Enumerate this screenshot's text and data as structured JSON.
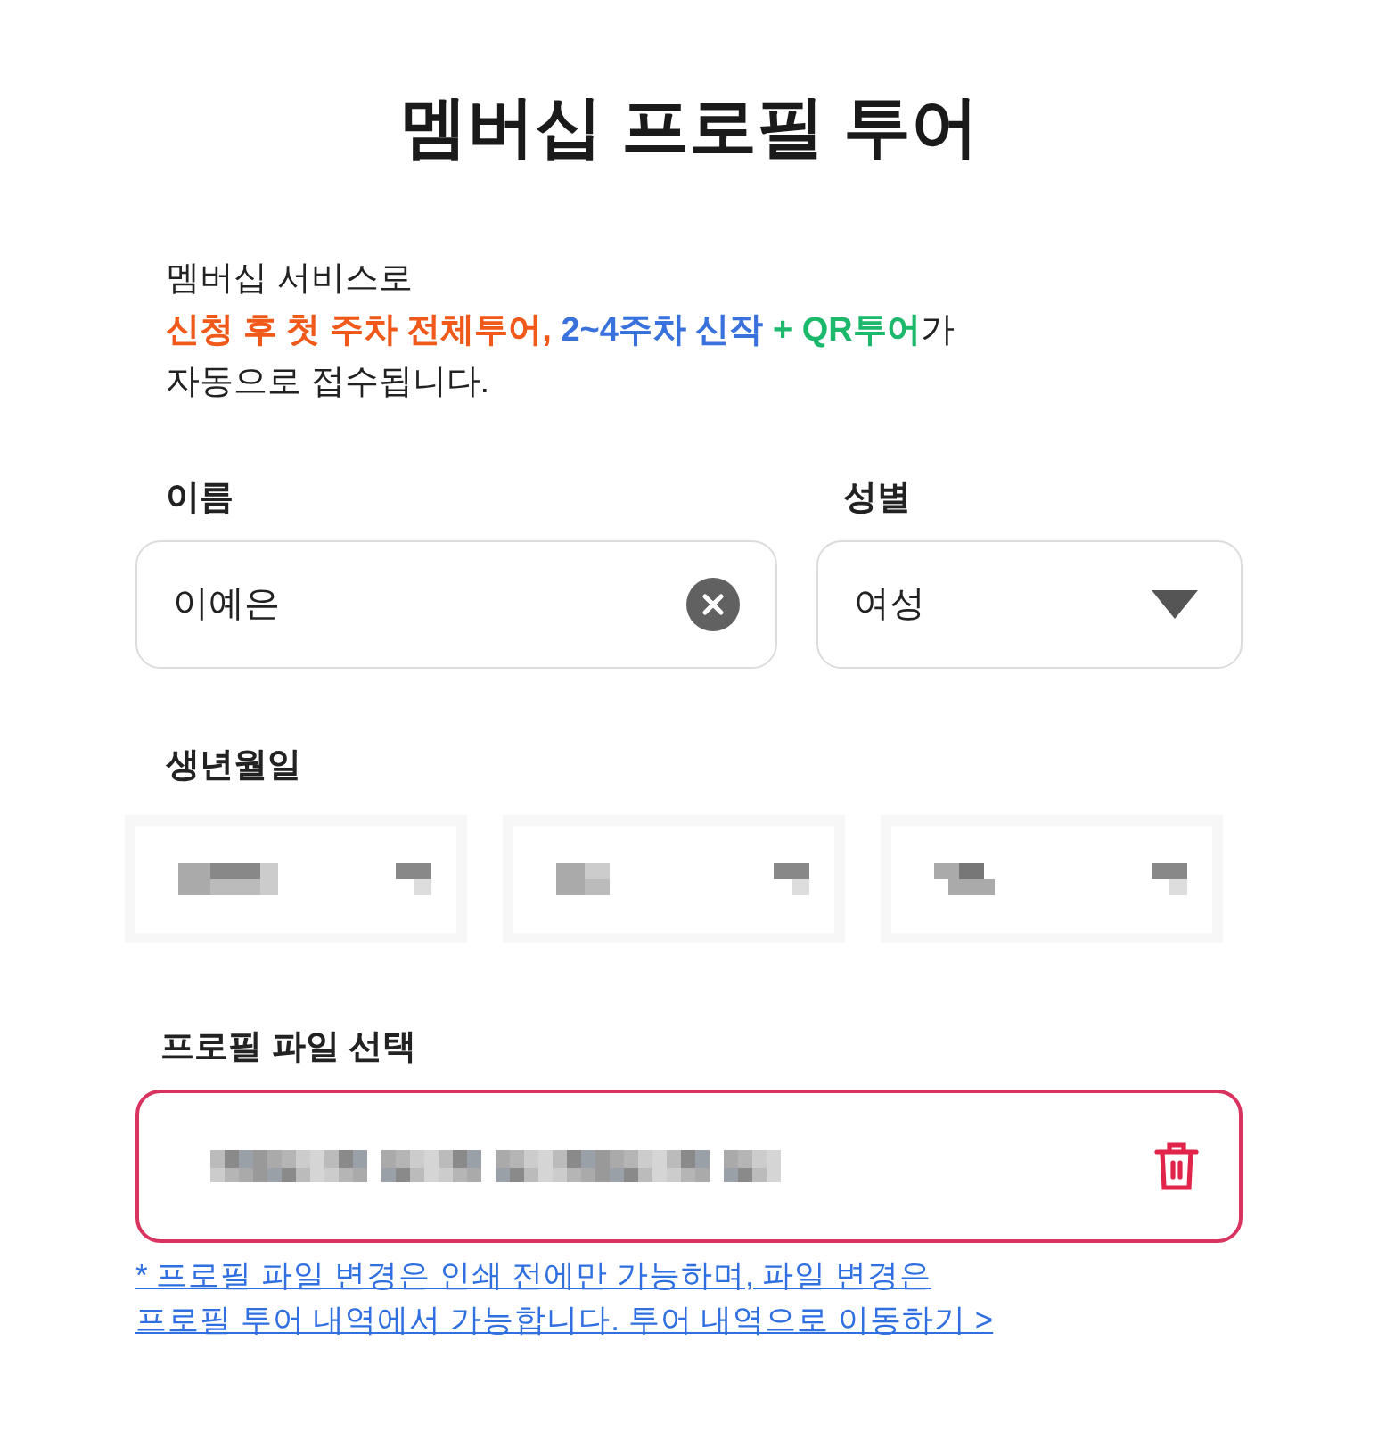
{
  "title": "멤버십 프로필 투어",
  "intro": [
    {
      "segments": [
        {
          "text": "멤버십 서비스로",
          "color": "#222222",
          "bold": false
        }
      ]
    },
    {
      "segments": [
        {
          "text": "신청 후 첫 주차 전체투어, ",
          "color": "#f0591a",
          "bold": true
        },
        {
          "text": "2~4주차 신작 ",
          "color": "#3a72dd",
          "bold": true
        },
        {
          "text": "+ QR투어",
          "color": "#1cb86b",
          "bold": true
        },
        {
          "text": "가",
          "color": "#222222",
          "bold": false
        }
      ]
    },
    {
      "segments": [
        {
          "text": "자동으로 접수됩니다.",
          "color": "#222222",
          "bold": false
        }
      ]
    }
  ],
  "name": {
    "label": "이름",
    "value": "이예은"
  },
  "gender": {
    "label": "성별",
    "value": "여성"
  },
  "birthdate": {
    "label": "생년월일",
    "fields": [
      {
        "kind": "redacted"
      },
      {
        "kind": "redacted"
      },
      {
        "kind": "redacted"
      }
    ]
  },
  "profile_file": {
    "label": "프로필 파일 선택",
    "kind": "redacted",
    "error": true
  },
  "notice_link": "* 프로필 파일 변경은 인쇄 전에만 가능하며, 파일 변경은 프로필 투어 내역에서 가능합니다. 투어 내역으로 이동하기 >"
}
